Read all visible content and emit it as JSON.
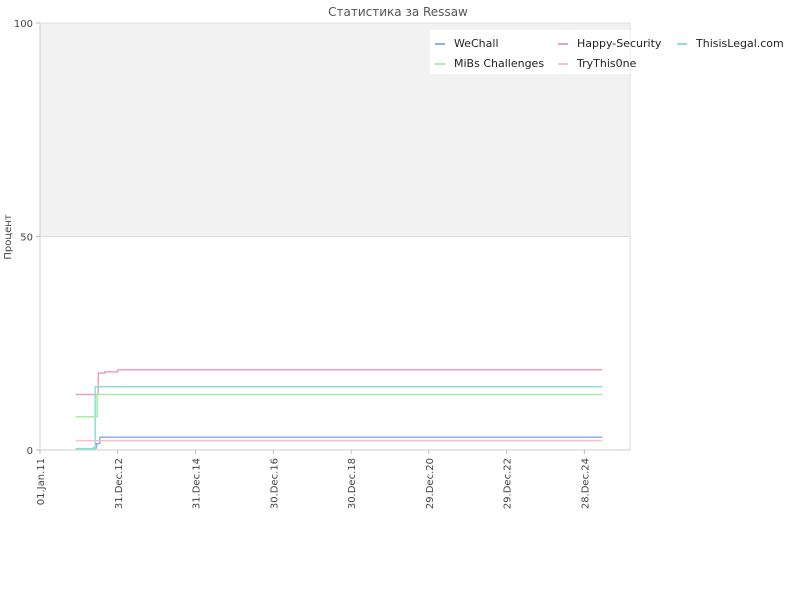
{
  "chart_data": {
    "type": "line",
    "title": "Статистика за Ressaw",
    "ylabel": "Процент",
    "xlabel": "",
    "ylim": [
      0,
      100
    ],
    "yticks": [
      "0",
      "50",
      "100"
    ],
    "xlim": [
      "2011-01-01",
      "2026-03-01"
    ],
    "xticks": [
      {
        "date": "2011-01-01",
        "label": "01.Jan.11"
      },
      {
        "date": "2012-12-31",
        "label": "31.Dec.12"
      },
      {
        "date": "2014-12-31",
        "label": "31.Dec.14"
      },
      {
        "date": "2016-12-30",
        "label": "30.Dec.16"
      },
      {
        "date": "2018-12-30",
        "label": "30.Dec.18"
      },
      {
        "date": "2020-12-29",
        "label": "29.Dec.20"
      },
      {
        "date": "2022-12-29",
        "label": "29.Dec.22"
      },
      {
        "date": "2024-12-28",
        "label": "28.Dec.24"
      }
    ],
    "upper_band": [
      50,
      100
    ],
    "band_color": "#f2f2f2",
    "grid": false,
    "legend_position": "top-right",
    "series": [
      {
        "name": "WeChall",
        "color": "#8fb2ea",
        "points": [
          [
            "2011-12-01",
            0.3
          ],
          [
            "2012-05-15",
            0.5
          ],
          [
            "2012-06-15",
            1.5
          ],
          [
            "2012-07-15",
            3
          ],
          [
            "2025-06-15",
            3
          ]
        ]
      },
      {
        "name": "Happy-Security",
        "color": "#f0a0bd",
        "points": [
          [
            "2011-12-01",
            13
          ],
          [
            "2012-06-01",
            13
          ],
          [
            "2012-07-01",
            18
          ],
          [
            "2012-09-01",
            18.3
          ],
          [
            "2013-01-01",
            18.8
          ],
          [
            "2025-06-15",
            18.8
          ]
        ]
      },
      {
        "name": "ThisisLegal.com",
        "color": "#88e0cf",
        "points": [
          [
            "2011-12-01",
            0.3
          ],
          [
            "2012-06-01",
            0.3
          ],
          [
            "2012-06-02",
            14.8
          ],
          [
            "2025-06-15",
            14.8
          ]
        ]
      },
      {
        "name": "MiBs Challenges",
        "color": "#a8eca8",
        "points": [
          [
            "2011-12-01",
            7.8
          ],
          [
            "2012-06-01",
            7.8
          ],
          [
            "2012-06-20",
            13
          ],
          [
            "2025-06-15",
            13
          ]
        ]
      },
      {
        "name": "TryThis0ne",
        "color": "#f7c0cc",
        "points": [
          [
            "2011-12-01",
            2.2
          ],
          [
            "2012-06-01",
            2.2
          ],
          [
            "2012-07-15",
            2.2
          ],
          [
            "2025-06-15",
            2.2
          ]
        ]
      }
    ]
  }
}
